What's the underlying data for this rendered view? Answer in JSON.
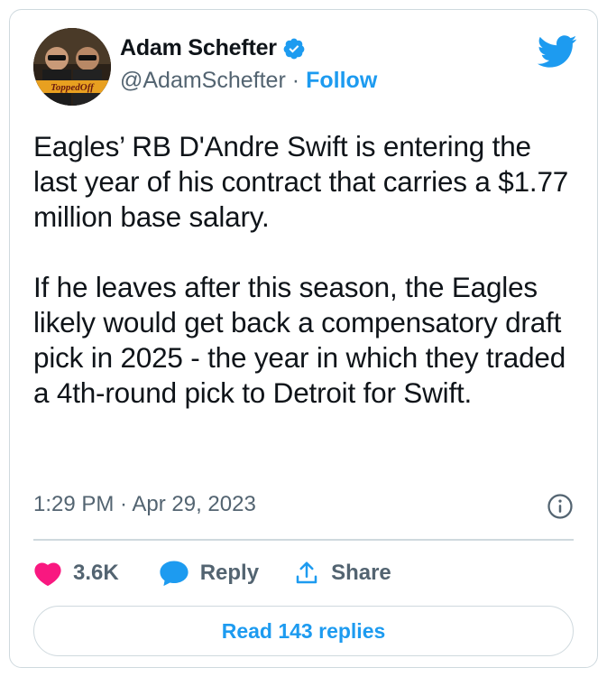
{
  "author": {
    "name": "Adam Schefter",
    "handle": "@AdamSchefter",
    "separator": "·",
    "follow_label": "Follow",
    "verified_color": "#1d9bf0",
    "avatar_caption": "ToppedOff"
  },
  "tweet": {
    "paragraphs": [
      "Eagles’ RB D'Andre Swift is entering the last year of his contract that carries a $1.77 million base salary.",
      "If he leaves after this season, the Eagles likely would get back a compensatory draft pick in 2025 - the year in which they traded a 4th-round pick to Detroit for Swift."
    ],
    "timestamp": "1:29 PM · Apr 29, 2023"
  },
  "actions": {
    "like_count": "3.6K",
    "reply_label": "Reply",
    "share_label": "Share"
  },
  "read_replies_label": "Read 143 replies",
  "icons": {
    "brand": "twitter-bird-icon",
    "verified": "verified-badge-icon",
    "info": "info-icon",
    "like": "heart-icon",
    "reply": "speech-bubble-icon",
    "share": "share-upload-icon"
  },
  "colors": {
    "accent": "#1d9bf0",
    "like": "#f91880",
    "text": "#0f1419",
    "secondary": "#536471",
    "border": "#cfd9de"
  }
}
